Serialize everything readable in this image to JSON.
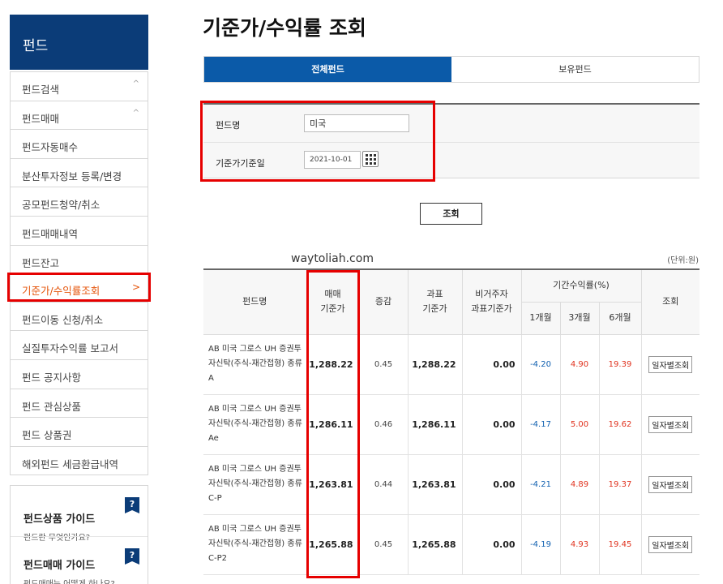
{
  "sidebar": {
    "title": "펀드",
    "items": [
      {
        "label": "펀드검색",
        "chevron": "^"
      },
      {
        "label": "펀드매매",
        "chevron": "^"
      },
      {
        "label": "펀드자동매수",
        "chevron": ""
      },
      {
        "label": "분산투자정보 등록/변경",
        "chevron": ""
      },
      {
        "label": "공모펀드청약/취소",
        "chevron": ""
      },
      {
        "label": "펀드매매내역",
        "chevron": ""
      },
      {
        "label": "펀드잔고",
        "chevron": ""
      },
      {
        "label": "기준가/수익률조회",
        "chevron": ">"
      },
      {
        "label": "펀드이동 신청/취소",
        "chevron": ""
      },
      {
        "label": "실질투자수익률 보고서",
        "chevron": ""
      },
      {
        "label": "펀드 공지사항",
        "chevron": ""
      },
      {
        "label": "펀드 관심상품",
        "chevron": ""
      },
      {
        "label": "펀드 상품권",
        "chevron": ""
      },
      {
        "label": "해외펀드 세금환급내역",
        "chevron": ""
      }
    ],
    "guides": [
      {
        "title": "펀드상품 가이드",
        "sub": "펀드란 무엇인가요?",
        "badge": "?"
      },
      {
        "title": "펀드매매 가이드",
        "sub": "펀드매매는 어떻게 하나요?",
        "badge": "?"
      }
    ]
  },
  "main": {
    "title": "기준가/수익률 조회",
    "tabs": [
      "전체펀드",
      "보유펀드"
    ],
    "form": {
      "fund_name_label": "펀드명",
      "fund_name_value": "미국",
      "date_label": "기준가기준일",
      "date_value": "2021-10-01"
    },
    "search_button": "조회",
    "watermark": "waytoliah.com",
    "unit_note": "(단위:원)",
    "table": {
      "headers": {
        "name": "펀드명",
        "price": "매매\n기준가",
        "change": "증감",
        "tax_price": "과표\n기준가",
        "nonres_tax_price": "비거주자\n과표기준가",
        "period_return": "기간수익률(%)",
        "m1": "1개월",
        "m3": "3개월",
        "m6": "6개월",
        "lookup": "조회"
      },
      "rows": [
        {
          "name": "AB 미국 그로스 UH 증권투자신탁(주식-재간접형) 종류 A",
          "price": "1,288.22",
          "change": "0.45",
          "tax_price": "1,288.22",
          "nonres": "0.00",
          "m1": "-4.20",
          "m3": "4.90",
          "m6": "19.39",
          "action": "일자별조회"
        },
        {
          "name": "AB 미국 그로스 UH 증권투자신탁(주식-재간접형) 종류 Ae",
          "price": "1,286.11",
          "change": "0.46",
          "tax_price": "1,286.11",
          "nonres": "0.00",
          "m1": "-4.17",
          "m3": "5.00",
          "m6": "19.62",
          "action": "일자별조회"
        },
        {
          "name": "AB 미국 그로스 UH 증권투자신탁(주식-재간접형) 종류 C-P",
          "price": "1,263.81",
          "change": "0.44",
          "tax_price": "1,263.81",
          "nonres": "0.00",
          "m1": "-4.21",
          "m3": "4.89",
          "m6": "19.37",
          "action": "일자별조회"
        },
        {
          "name": "AB 미국 그로스 UH 증권투자신탁(주식-재간접형) 종류 C-P2",
          "price": "1,265.88",
          "change": "0.45",
          "tax_price": "1,265.88",
          "nonres": "0.00",
          "m1": "-4.19",
          "m3": "4.93",
          "m6": "19.45",
          "action": "일자별조회"
        }
      ]
    }
  },
  "colors": {
    "brand_navy": "#0b3c78",
    "tab_blue": "#0b5aa8",
    "highlight_red": "#e60000",
    "negative_blue": "#1060b0",
    "positive_red": "#e0321e",
    "active_orange": "#e5540a"
  },
  "icons": {
    "calendar": "calendar-icon",
    "help_badge": "help-badge-icon"
  },
  "state": {
    "active_sidebar_item": "기준가/수익률조회",
    "active_tab": "전체펀드"
  }
}
